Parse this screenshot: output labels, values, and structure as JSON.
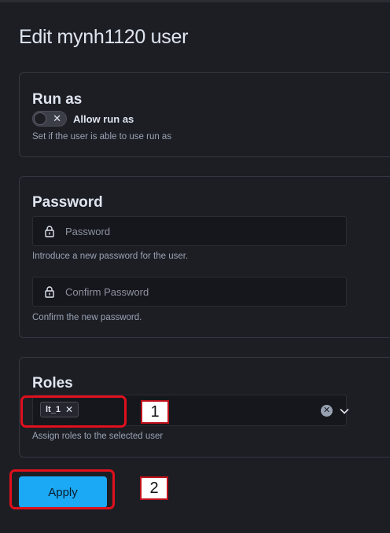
{
  "page": {
    "title": "Edit mynh1120 user"
  },
  "run_as": {
    "title": "Run as",
    "toggle_label": "Allow run as",
    "toggle_on": false,
    "help": "Set if the user is able to use run as"
  },
  "password": {
    "title": "Password",
    "password_placeholder": "Password",
    "password_help": "Introduce a new password for the user.",
    "confirm_placeholder": "Confirm Password",
    "confirm_help": "Confirm the new password."
  },
  "roles": {
    "title": "Roles",
    "selected": [
      "lt_1"
    ],
    "help": "Assign roles to the selected user"
  },
  "actions": {
    "apply_label": "Apply"
  },
  "annotations": {
    "marker_1": "1",
    "marker_2": "2"
  },
  "colors": {
    "accent": "#1ba9f5",
    "background": "#1d1e24",
    "annotation": "#e0101c"
  }
}
